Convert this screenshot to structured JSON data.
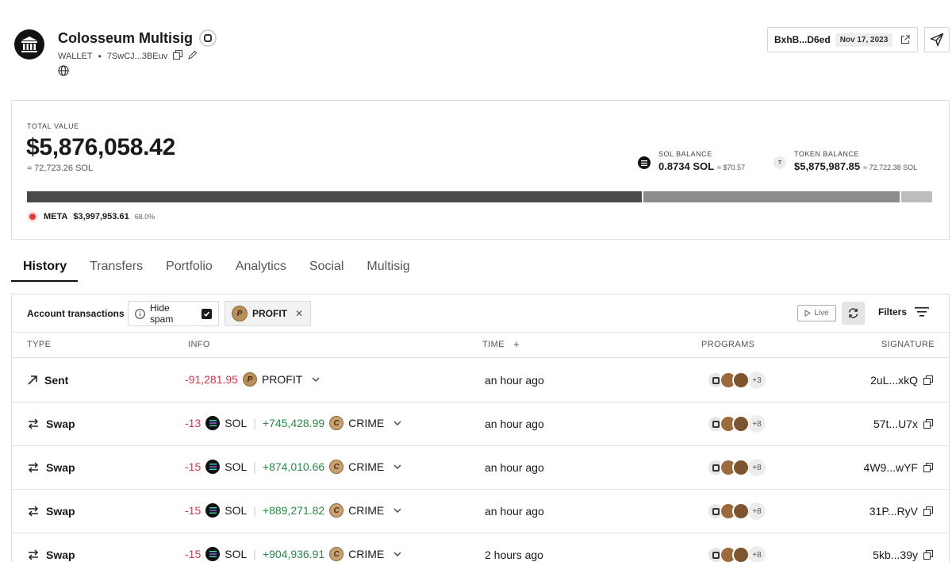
{
  "wallet": {
    "name": "Colosseum Multisig",
    "type_label": "WALLET",
    "address_short": "7SwCJ...3BEuv"
  },
  "header": {
    "signature_short": "BxhB...D6ed",
    "date": "Nov 17, 2023"
  },
  "summary": {
    "total_label": "TOTAL VALUE",
    "total_value": "$5,876,058.42",
    "total_sol": "≈ 72,723.26 SOL",
    "sol_balance_label": "SOL BALANCE",
    "sol_balance": "0.8734 SOL",
    "sol_balance_usd": "≈ $70.57",
    "token_balance_label": "TOKEN BALANCE",
    "token_icon_letter": "T",
    "token_balance": "$5,875,987.85",
    "token_balance_sol": "≈ 72,722.38 SOL",
    "allocation": [
      {
        "share": 68.0,
        "color": "#4a4a4a"
      },
      {
        "share": 28.4,
        "color": "#8c8c8c"
      },
      {
        "share": 3.6,
        "color": "#bdbdbd"
      }
    ],
    "top_holding": {
      "name": "META",
      "value": "$3,997,953.61",
      "pct": "68.0%",
      "color": "#e23b3b"
    }
  },
  "tabs": [
    "History",
    "Transfers",
    "Portfolio",
    "Analytics",
    "Social",
    "Multisig"
  ],
  "toolbar": {
    "account_label": "Account transactions",
    "hide_spam_label": "Hide spam",
    "filter_token": "PROFIT",
    "filter_token_letter": "P",
    "live_label": "Live",
    "filters_label": "Filters"
  },
  "table": {
    "columns": {
      "type": "TYPE",
      "info": "INFO",
      "time": "TIME",
      "time_add": "+",
      "programs": "PROGRAMS",
      "signature": "SIGNATURE"
    },
    "rows": [
      {
        "type": "Sent",
        "out_amount": "-91,281.95",
        "out_token": "PROFIT",
        "out_letter": "P",
        "in_amount": "",
        "in_token": "",
        "in_letter": "",
        "time": "an hour ago",
        "more_programs": "+3",
        "signature": "2uL...xkQ"
      },
      {
        "type": "Swap",
        "out_amount": "-13",
        "out_token": "SOL",
        "out_letter": "",
        "in_amount": "+745,428.99",
        "in_token": "CRIME",
        "in_letter": "C",
        "time": "an hour ago",
        "more_programs": "+8",
        "signature": "57t...U7x"
      },
      {
        "type": "Swap",
        "out_amount": "-15",
        "out_token": "SOL",
        "out_letter": "",
        "in_amount": "+874,010.66",
        "in_token": "CRIME",
        "in_letter": "C",
        "time": "an hour ago",
        "more_programs": "+8",
        "signature": "4W9...wYF"
      },
      {
        "type": "Swap",
        "out_amount": "-15",
        "out_token": "SOL",
        "out_letter": "",
        "in_amount": "+889,271.82",
        "in_token": "CRIME",
        "in_letter": "C",
        "time": "an hour ago",
        "more_programs": "+8",
        "signature": "31P...RyV"
      },
      {
        "type": "Swap",
        "out_amount": "-15",
        "out_token": "SOL",
        "out_letter": "",
        "in_amount": "+904,936.91",
        "in_token": "CRIME",
        "in_letter": "C",
        "time": "2 hours ago",
        "more_programs": "+8",
        "signature": "5kb...39y"
      }
    ]
  },
  "icons": {
    "logo": "colosseum-logo-icon",
    "copy": "copy-icon",
    "edit": "pencil-icon",
    "globe": "globe-icon",
    "external": "external-link-icon",
    "send": "send-icon",
    "sent": "arrow-up-right-icon",
    "swap": "swap-arrows-icon",
    "refresh": "refresh-icon",
    "filter": "filter-lines-icon",
    "info": "info-icon"
  }
}
